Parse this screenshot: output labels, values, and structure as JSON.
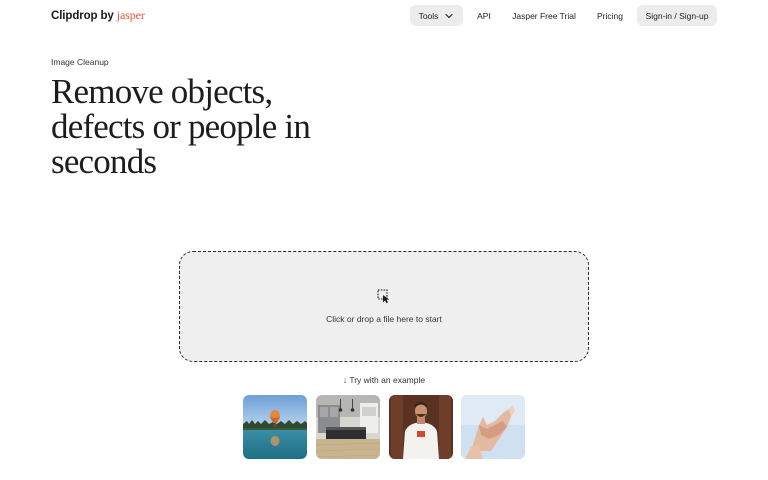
{
  "header": {
    "brand_name": "Clipdrop",
    "brand_by": "by",
    "brand_partner": "jasper",
    "nav": {
      "tools": "Tools",
      "api": "API",
      "trial": "Jasper Free Trial",
      "pricing": "Pricing",
      "signin": "Sign-in / Sign-up"
    }
  },
  "hero": {
    "eyebrow": "Image Cleanup",
    "title_lines": [
      "Remove objects,",
      "defects or people in",
      "seconds"
    ]
  },
  "upload": {
    "prompt": "Click or drop a file here to start",
    "try_label": "↓ Try with an example"
  },
  "examples": [
    {
      "icon": "lake-balloon-image"
    },
    {
      "icon": "kitchen-image"
    },
    {
      "icon": "man-tshirt-image"
    },
    {
      "icon": "hand-fabric-image"
    }
  ],
  "colors": {
    "brand_accent": "#e0533b",
    "pill_bg": "#ececec",
    "dropzone_bg": "#efefef"
  }
}
